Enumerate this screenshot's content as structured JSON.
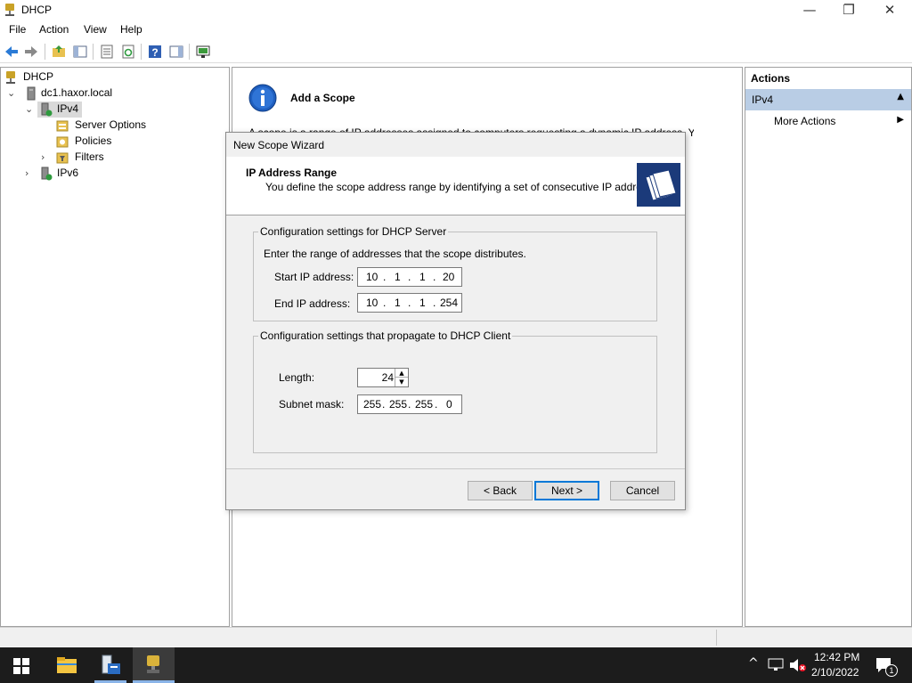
{
  "window": {
    "title": "DHCP",
    "minimize": "—",
    "restore": "❐",
    "close": "✕"
  },
  "menu": [
    "File",
    "Action",
    "View",
    "Help"
  ],
  "tree": {
    "root": "DHCP",
    "server": "dc1.haxor.local",
    "ipv4": "IPv4",
    "server_options": "Server Options",
    "policies": "Policies",
    "filters": "Filters",
    "ipv6": "IPv6"
  },
  "center": {
    "heading": "Add a Scope",
    "intro_partial": "A scope is a range of IP addresses assigned to computers requesting a dynamic IP address. You"
  },
  "actions": {
    "header": "Actions",
    "section": "IPv4",
    "more": "More Actions"
  },
  "wizard": {
    "title": "New Scope Wizard",
    "page_title": "IP Address Range",
    "page_desc": "You define the scope address range by identifying a set of consecutive IP addresses.",
    "group1": {
      "legend": "Configuration settings for DHCP Server",
      "prompt": "Enter the range of addresses that the scope distributes.",
      "start_label": "Start IP address:",
      "start_ip": [
        "10",
        "1",
        "1",
        "20"
      ],
      "end_label": "End IP address:",
      "end_ip": [
        "10",
        "1",
        "1",
        "254"
      ]
    },
    "group2": {
      "legend": "Configuration settings that propagate to DHCP Client",
      "length_label": "Length:",
      "length_value": "24",
      "mask_label": "Subnet mask:",
      "mask": [
        "255",
        "255",
        "255",
        "0"
      ]
    },
    "buttons": {
      "back": "< Back",
      "next": "Next >",
      "cancel": "Cancel"
    }
  },
  "taskbar": {
    "time": "12:42 PM",
    "date": "2/10/2022",
    "notif_count": "1"
  },
  "colors": {
    "accent": "#0078d7",
    "actions_section": "#b9cde5",
    "taskbar": "#1c1c1c"
  }
}
